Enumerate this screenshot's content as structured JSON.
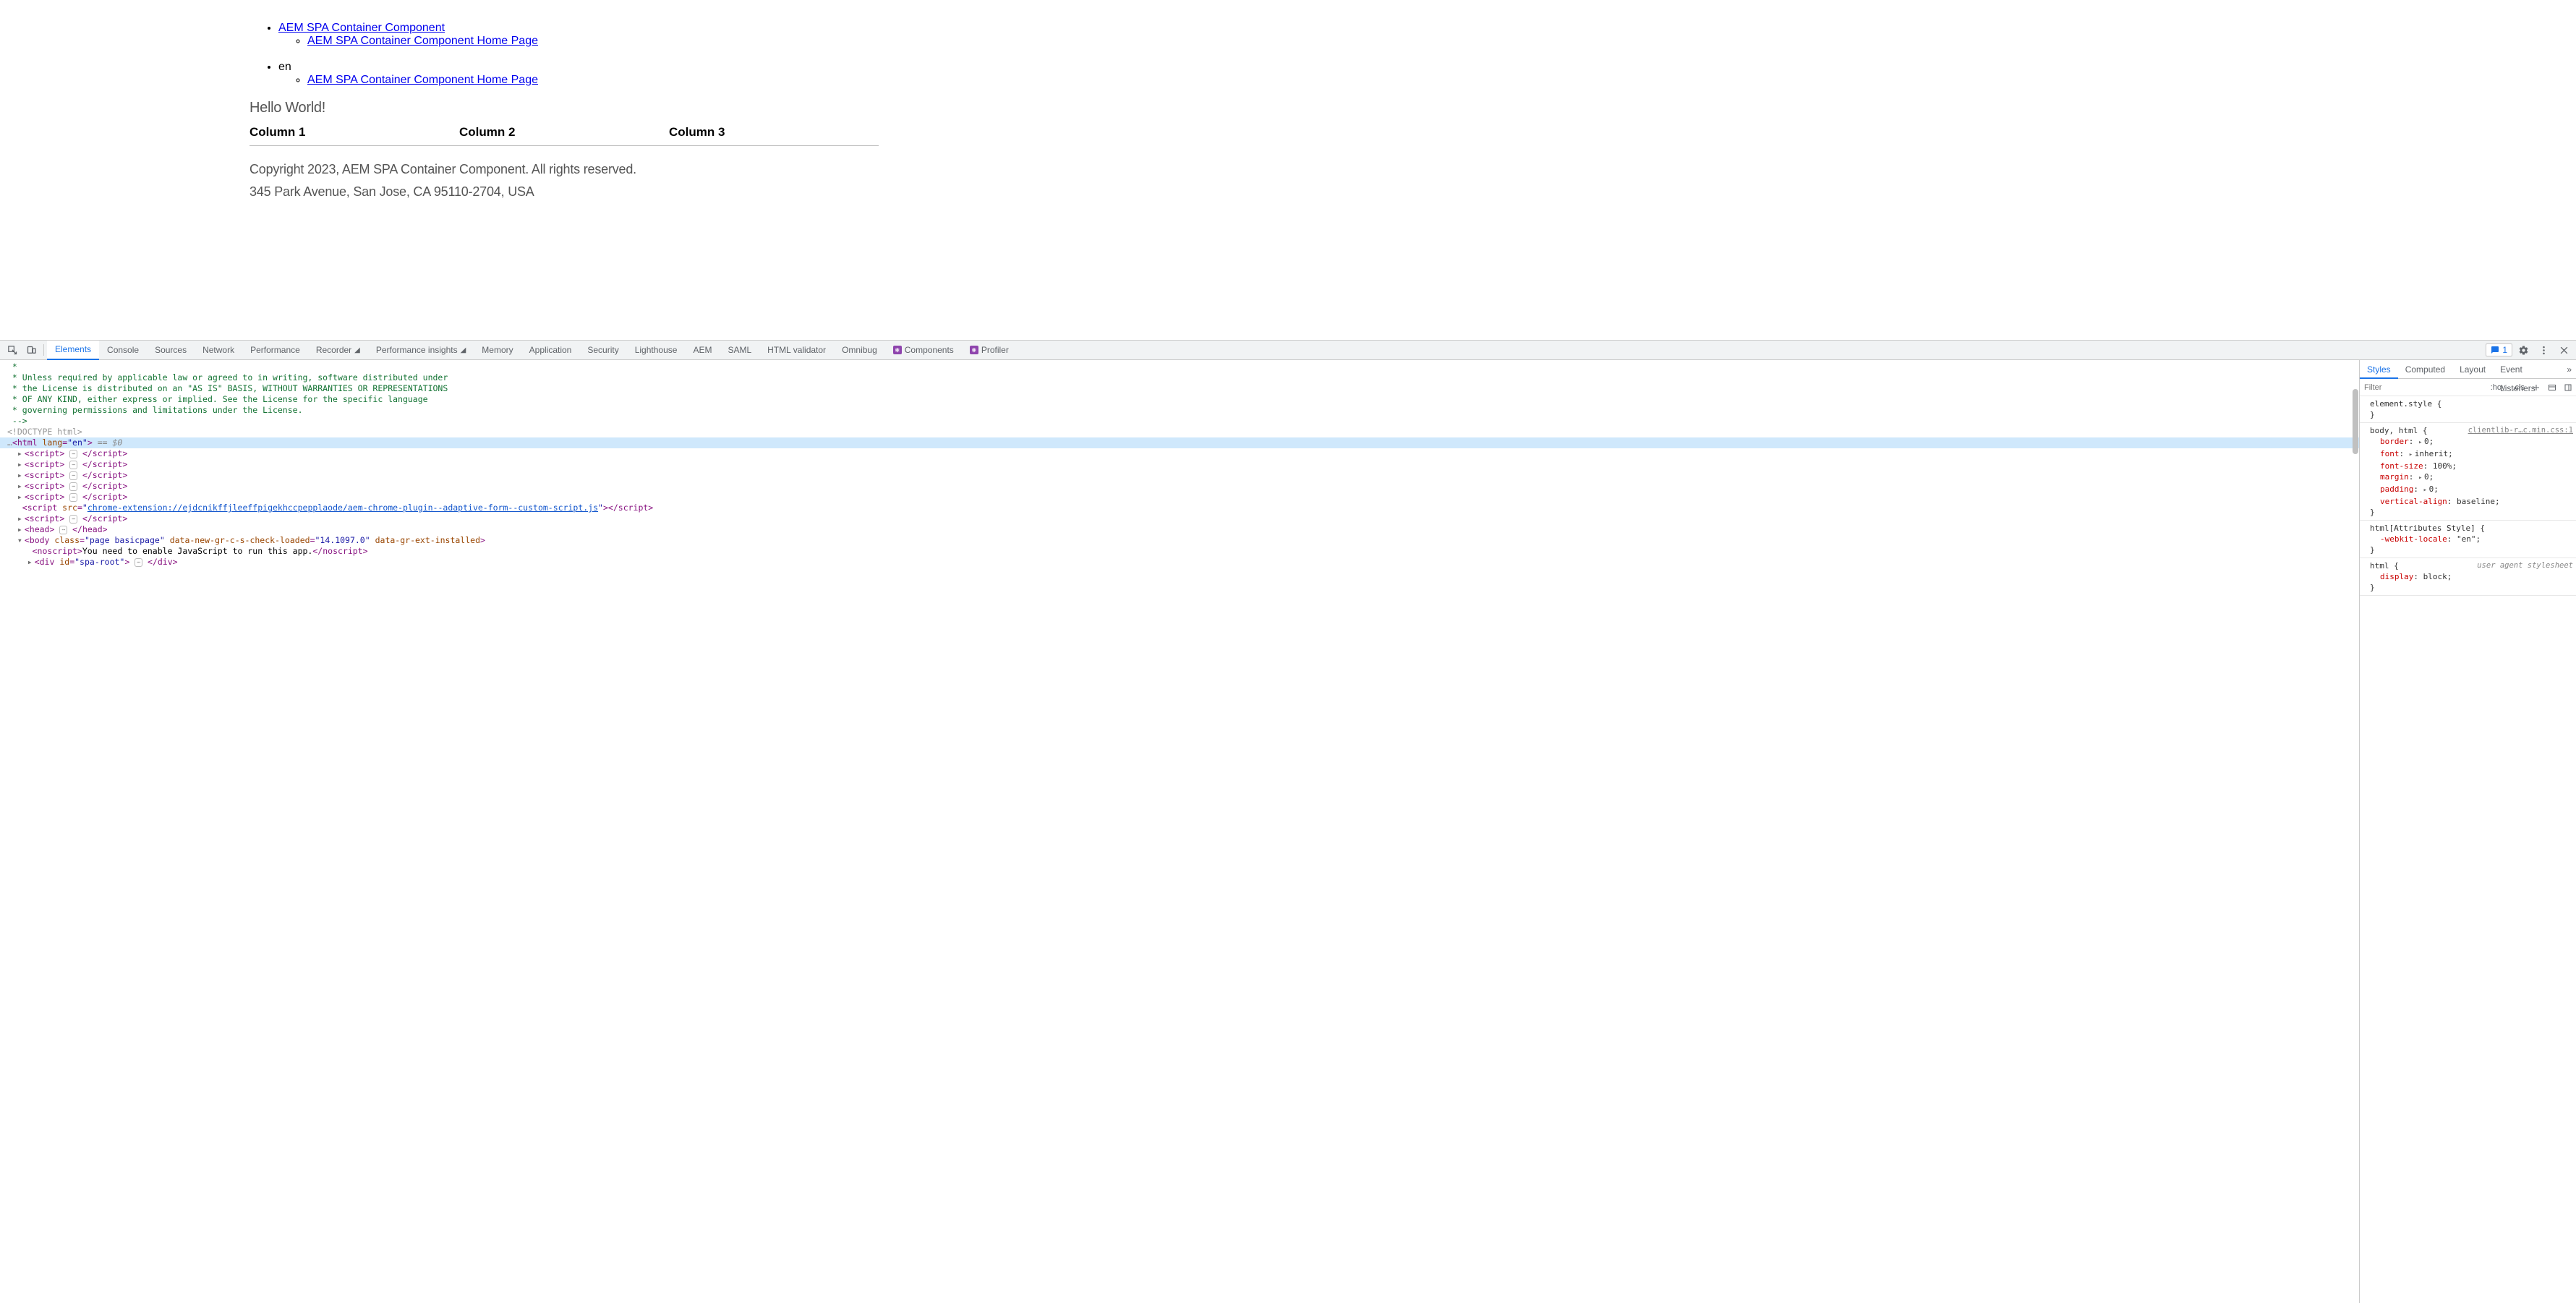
{
  "page": {
    "nav1": {
      "root": "AEM SPA Container Component",
      "child": "AEM SPA Container Component Home Page"
    },
    "nav2": {
      "root": "en",
      "child": "AEM SPA Container Component Home Page"
    },
    "hello": "Hello World!",
    "columns": [
      "Column 1",
      "Column 2",
      "Column 3"
    ],
    "copyright": "Copyright 2023, AEM SPA Container Component. All rights reserved.",
    "address": "345 Park Avenue, San Jose, CA 95110-2704, USA"
  },
  "devtools": {
    "tabs": {
      "elements": "Elements",
      "console": "Console",
      "sources": "Sources",
      "network": "Network",
      "performance": "Performance",
      "recorder": "Recorder",
      "perf_insights": "Performance insights",
      "memory": "Memory",
      "application": "Application",
      "security": "Security",
      "lighthouse": "Lighthouse",
      "aem": "AEM",
      "saml": "SAML",
      "html_validator": "HTML validator",
      "omnibug": "Omnibug",
      "components": "Components",
      "profiler": "Profiler"
    },
    "issues_count": "1",
    "dom": {
      "comment_l1": " *",
      "comment_l2": " * Unless required by applicable law or agreed to in writing, software distributed under",
      "comment_l3": " * the License is distributed on an \"AS IS\" BASIS, WITHOUT WARRANTIES OR REPRESENTATIONS",
      "comment_l4": " * OF ANY KIND, either express or implied. See the License for the specific language",
      "comment_l5": " * governing permissions and limitations under the License.",
      "comment_l6": " -->",
      "doctype": "<!DOCTYPE html>",
      "html_open_pre": "<html ",
      "html_lang_attr": "lang",
      "html_lang_val": "\"en\"",
      "html_open_post": ">",
      "html_sel": " == $0",
      "script_open": "<script>",
      "script_close": "</script>",
      "script_src_pre": "<script ",
      "script_src_attr": "src",
      "script_src_val": "chrome-extension://ejdcnikffjleeffpigekhccpepplaode/aem-chrome-plugin--adaptive-form--custom-script.js",
      "script_src_post": ">",
      "head_open": "<head>",
      "head_close": "</head>",
      "body_open_pre": "<body ",
      "body_class_attr": "class",
      "body_class_val": "\"page basicpage\"",
      "body_gr_attr": "data-new-gr-c-s-check-loaded",
      "body_gr_val": "\"14.1097.0\"",
      "body_ext_attr": "data-gr-ext-installed",
      "body_open_post": ">",
      "noscript_open": "<noscript>",
      "noscript_text": "You need to enable JavaScript to run this app.",
      "noscript_close": "</noscript>",
      "div_open_pre": "<div ",
      "div_id_attr": "id",
      "div_id_val": "\"spa-root\"",
      "div_open_post": ">",
      "div_close": "</div>"
    },
    "styles": {
      "tabs": {
        "styles": "Styles",
        "computed": "Computed",
        "layout": "Layout",
        "listeners": "Event Listeners"
      },
      "filter_placeholder": "Filter",
      "hov": ":hov",
      "cls": ".cls",
      "r1": {
        "sel": "element.style {",
        "close": "}"
      },
      "r2": {
        "sel": "body, html {",
        "src": "clientlib-r…c.min.css:1",
        "d1p": "border",
        "d1v": "0",
        "d2p": "font",
        "d2v": "inherit",
        "d3p": "font-size",
        "d3v": "100%",
        "d4p": "margin",
        "d4v": "0",
        "d5p": "padding",
        "d5v": "0",
        "d6p": "vertical-align",
        "d6v": "baseline",
        "close": "}"
      },
      "r3": {
        "sel": "html[Attributes Style] {",
        "d1p": "-webkit-locale",
        "d1v": "\"en\"",
        "close": "}"
      },
      "r4": {
        "sel": "html {",
        "src": "user agent stylesheet",
        "d1p": "display",
        "d1v": "block",
        "close": "}"
      }
    }
  }
}
